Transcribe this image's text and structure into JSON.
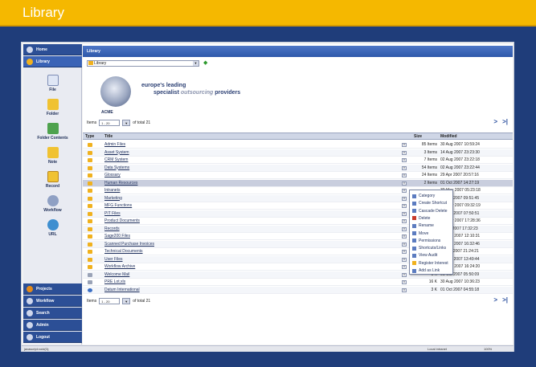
{
  "header": {
    "title": "Library"
  },
  "sidebar": {
    "top": [
      {
        "label": "Home",
        "icon": "home-icon"
      },
      {
        "label": "Library",
        "icon": "library-icon"
      }
    ],
    "tools": [
      {
        "label": "File",
        "icon": "file-icon"
      },
      {
        "label": "Folder",
        "icon": "folder-icon"
      },
      {
        "label": "Folder Contents",
        "icon": "folder-contents-icon"
      },
      {
        "label": "Note",
        "icon": "note-icon"
      },
      {
        "label": "Record",
        "icon": "record-icon"
      },
      {
        "label": "Workflow",
        "icon": "workflow-icon"
      },
      {
        "label": "URL",
        "icon": "url-icon"
      }
    ],
    "bottom": [
      {
        "label": "Projects"
      },
      {
        "label": "Workflow"
      },
      {
        "label": "Search"
      },
      {
        "label": "Admin"
      },
      {
        "label": "Logout"
      }
    ]
  },
  "main": {
    "title": "Library",
    "library_select": "Library",
    "logo": {
      "name": "ACME",
      "tagline1": "europe's leading",
      "tagline2a": "specialist",
      "tagline2b": "outsourcing",
      "tagline2c": "providers"
    },
    "pager": {
      "items_label": "Items",
      "range": "1 - 20",
      "of_total": "of total 21"
    },
    "columns": {
      "type": "Type",
      "title": "Title",
      "size": "Size",
      "modified": "Modified"
    },
    "rows": [
      {
        "name": "Admin Files",
        "size": "85 Items",
        "date": "30 Aug 2007 10:59:24",
        "icon": "folder"
      },
      {
        "name": "Asset System",
        "size": "3 Items",
        "date": "14 Aug 2007 23:23:30",
        "icon": "folder"
      },
      {
        "name": "CRM System",
        "size": "7 Items",
        "date": "02 Aug 2007 23:22:18",
        "icon": "folder"
      },
      {
        "name": "Data Systems",
        "size": "54 Items",
        "date": "02 Aug 2007 23:22:44",
        "icon": "folder"
      },
      {
        "name": "Glossary",
        "size": "24 Items",
        "date": "29 Apr 2007 20:57:16",
        "icon": "folder"
      },
      {
        "name": "Human Resources",
        "size": "2 Items",
        "date": "01 Oct 2007 14:27:19",
        "icon": "folder"
      },
      {
        "name": "Intranets",
        "size": "",
        "date": "30 May 2007 05:23:18",
        "icon": "folder"
      },
      {
        "name": "Marketing",
        "size": "",
        "date": "07 Oct 2007 09:51:45",
        "icon": "folder"
      },
      {
        "name": "MFG Functions",
        "size": "",
        "date": "16 May 2007 09:32:19",
        "icon": "folder"
      },
      {
        "name": "PIT Files",
        "size": "",
        "date": "10 Jun 2007 07:50:51",
        "icon": "folder"
      },
      {
        "name": "Product Documents",
        "size": "",
        "date": "19 May 2007 17:28:36",
        "icon": "folder"
      },
      {
        "name": "Records",
        "size": "",
        "date": "01 Jul 2007 17:32:23",
        "icon": "folder"
      },
      {
        "name": "Sage200 Files",
        "size": "",
        "date": "03 Sep 2007 12:10:31",
        "icon": "folder"
      },
      {
        "name": "Scanned Purchase Invoices",
        "size": "",
        "date": "27 Feb 2007 16:32:46",
        "icon": "folder"
      },
      {
        "name": "Technical Documents",
        "size": "",
        "date": "29 Apr 2007 21:24:21",
        "icon": "folder"
      },
      {
        "name": "User Files",
        "size": "",
        "date": "11 Feb 2007 13:49:44",
        "icon": "folder"
      },
      {
        "name": "Workflow Archive",
        "size": "2 Items",
        "date": "04 Sep 2007 16:24:20",
        "icon": "folder"
      },
      {
        "name": "Welcome Mail",
        "size": "1 K",
        "date": "01 Oct 2007 05:50:09",
        "icon": "mail"
      },
      {
        "name": "PRE Lot.xls",
        "size": "16 K",
        "date": "30 Aug 2007 10:36:23",
        "icon": "sheet"
      },
      {
        "name": "Datum International",
        "size": "3 K",
        "date": "01 Oct 2007 04:55:18",
        "icon": "web"
      }
    ],
    "context_menu": [
      {
        "label": "Category",
        "c": ""
      },
      {
        "label": "Create Shortcut",
        "c": ""
      },
      {
        "label": "Cascade Delete",
        "c": ""
      },
      {
        "label": "Delete",
        "c": "r"
      },
      {
        "label": "Rename",
        "c": ""
      },
      {
        "label": "Move",
        "c": ""
      },
      {
        "label": "Permissions",
        "c": ""
      },
      {
        "label": "Shortcuts/Links",
        "c": ""
      },
      {
        "label": "View Audit",
        "c": ""
      },
      {
        "label": "Register Interest",
        "c": "y"
      },
      {
        "label": "Add as Link",
        "c": ""
      }
    ]
  },
  "status": {
    "left": "javascript:void(0);",
    "center": "Local intranet",
    "zoom": "100%"
  }
}
